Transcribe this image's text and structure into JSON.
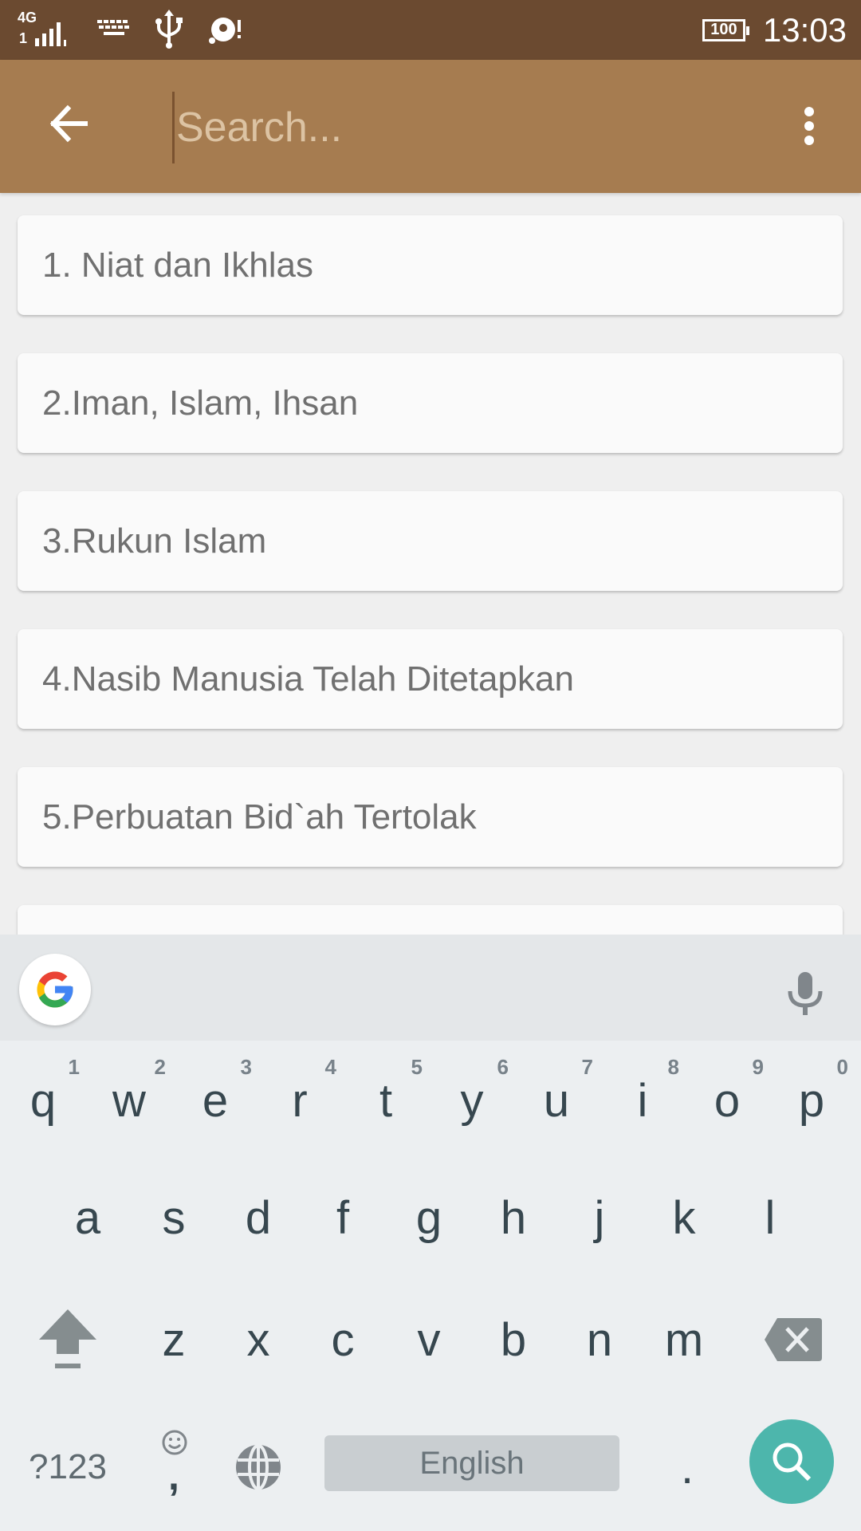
{
  "status_bar": {
    "network_label": "4G",
    "sim_label": "1",
    "battery_level": "100",
    "time": "13:03",
    "icons": [
      "signal-icon",
      "keyboard-icon",
      "usb-icon",
      "disk-icon",
      "battery-icon"
    ]
  },
  "app_bar": {
    "back_icon": "arrow-left-icon",
    "search_placeholder": "Search...",
    "search_value": "",
    "menu_icon": "more-vert-icon",
    "color": "#a67c50",
    "status_color": "#6b4a30"
  },
  "list": {
    "items": [
      {
        "label": "1. Niat dan Ikhlas"
      },
      {
        "label": "2.Iman, Islam, Ihsan"
      },
      {
        "label": "3.Rukun Islam"
      },
      {
        "label": "4.Nasib Manusia Telah Ditetapkan"
      },
      {
        "label": "5.Perbuatan Bid`ah Tertolak"
      },
      {
        "label": ""
      }
    ]
  },
  "keyboard": {
    "row1": [
      {
        "key": "q",
        "hint": "1"
      },
      {
        "key": "w",
        "hint": "2"
      },
      {
        "key": "e",
        "hint": "3"
      },
      {
        "key": "r",
        "hint": "4"
      },
      {
        "key": "t",
        "hint": "5"
      },
      {
        "key": "y",
        "hint": "6"
      },
      {
        "key": "u",
        "hint": "7"
      },
      {
        "key": "i",
        "hint": "8"
      },
      {
        "key": "o",
        "hint": "9"
      },
      {
        "key": "p",
        "hint": "0"
      }
    ],
    "row2": [
      "a",
      "s",
      "d",
      "f",
      "g",
      "h",
      "j",
      "k",
      "l"
    ],
    "row3": [
      "z",
      "x",
      "c",
      "v",
      "b",
      "n",
      "m"
    ],
    "symbols_label": "?123",
    "comma_label": ",",
    "space_label": "English",
    "period_label": ".",
    "action_color": "#4db6ac"
  }
}
